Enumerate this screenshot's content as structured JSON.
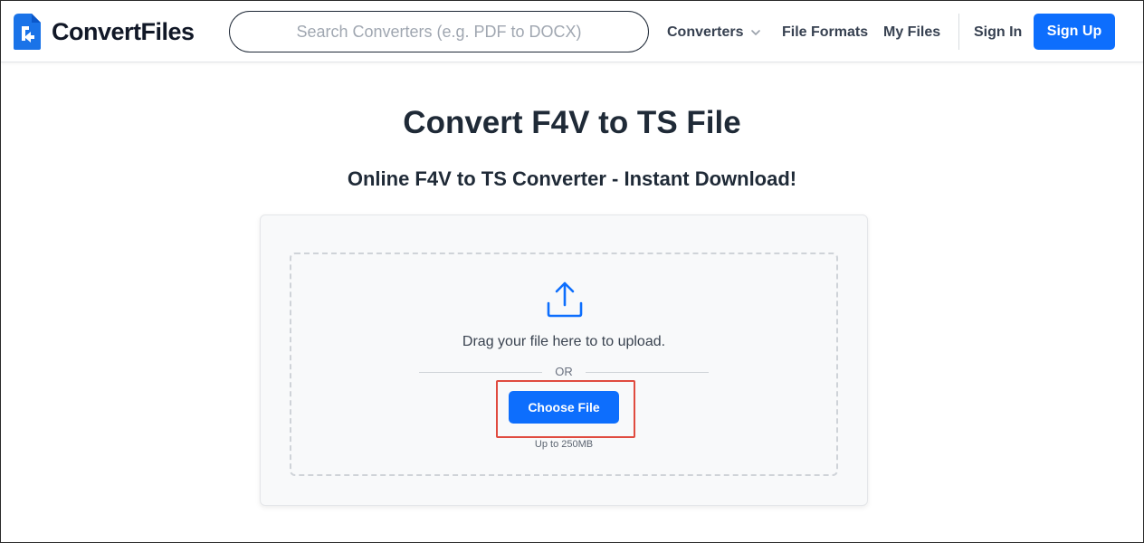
{
  "header": {
    "brand": "ConvertFiles",
    "search": {
      "placeholder": "Search Converters (e.g. PDF to DOCX)",
      "value": ""
    },
    "nav": {
      "converters": "Converters",
      "file_formats": "File Formats",
      "my_files": "My Files",
      "sign_in": "Sign In",
      "sign_up": "Sign Up"
    }
  },
  "main": {
    "title": "Convert F4V to TS File",
    "subtitle": "Online F4V to TS Converter - Instant Download!",
    "upload": {
      "drag_text": "Drag your file here to to upload.",
      "or_text": "OR",
      "choose_button": "Choose File",
      "limit_text": "Up to 250MB"
    }
  },
  "icons": {
    "logo": "convertfiles-logo-icon",
    "converters_dropdown": "chevron-down-icon",
    "upload": "upload-icon"
  },
  "colors": {
    "accent": "#0d6efd",
    "highlight": "#e04b3f",
    "heading": "#1f2a37"
  }
}
